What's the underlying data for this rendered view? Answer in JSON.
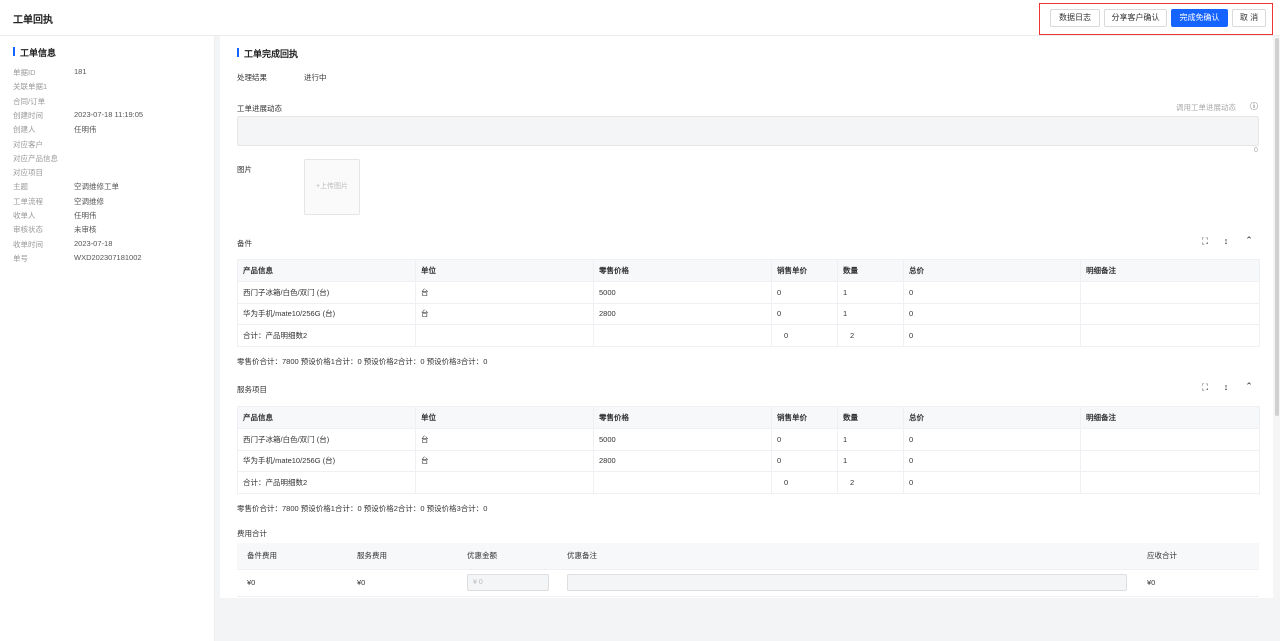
{
  "header": {
    "title": "工单回执",
    "buttons": {
      "log": "数据日志",
      "share": "分享客户确认",
      "confirm": "完成免确认",
      "cancel": "取 消"
    }
  },
  "info": {
    "title": "工单信息",
    "rows": [
      {
        "k": "单据ID",
        "v": "181"
      },
      {
        "k": "关联单据1",
        "v": ""
      },
      {
        "k": "合同/订单",
        "v": ""
      },
      {
        "k": "创建时间",
        "v": "2023-07-18 11:19:05"
      },
      {
        "k": "创建人",
        "v": "任明伟"
      },
      {
        "k": "对应客户",
        "v": ""
      },
      {
        "k": "对应产品信息",
        "v": ""
      },
      {
        "k": "对应项目",
        "v": ""
      },
      {
        "k": "主题",
        "v": "空调维修工单"
      },
      {
        "k": "工单流程",
        "v": "空调维修"
      },
      {
        "k": "收单人",
        "v": "任明伟"
      },
      {
        "k": "审核状态",
        "v": "未审核"
      },
      {
        "k": "收单时间",
        "v": "2023-07-18"
      },
      {
        "k": "单号",
        "v": "WXD202307181002"
      }
    ]
  },
  "receipt": {
    "title": "工单完成回执",
    "result_label": "处理结果",
    "result_value": "进行中",
    "progress_label": "工单进展动态",
    "progress_link": "调用工单进展动态",
    "char_count": "0",
    "image_label": "图片",
    "upload_label": "+上传图片"
  },
  "parts": {
    "title": "备件",
    "columns": [
      "产品信息",
      "单位",
      "零售价格",
      "销售单价",
      "数量",
      "总价",
      "明细备注"
    ],
    "rows": [
      {
        "name": "西门子冰箱/白色/双门 (台)",
        "unit": "台",
        "retail": "5000",
        "price": "0",
        "qty": "1",
        "total": "0",
        "note": ""
      },
      {
        "name": "华为手机/mate10/256G (台)",
        "unit": "台",
        "retail": "2800",
        "price": "0",
        "qty": "1",
        "total": "0",
        "note": ""
      }
    ],
    "total_row": {
      "label": "合计：产品明细数2",
      "price": "0",
      "qty": "2",
      "total": "0"
    },
    "summary": "零售价合计：7800  预设价格1合计：0  预设价格2合计：0  预设价格3合计：0"
  },
  "services": {
    "title": "服务项目",
    "columns": [
      "产品信息",
      "单位",
      "零售价格",
      "销售单价",
      "数量",
      "总价",
      "明细备注"
    ],
    "rows": [
      {
        "name": "西门子冰箱/白色/双门 (台)",
        "unit": "台",
        "retail": "5000",
        "price": "0",
        "qty": "1",
        "total": "0",
        "note": ""
      },
      {
        "name": "华为手机/mate10/256G (台)",
        "unit": "台",
        "retail": "2800",
        "price": "0",
        "qty": "1",
        "total": "0",
        "note": ""
      }
    ],
    "total_row": {
      "label": "合计：产品明细数2",
      "price": "0",
      "qty": "2",
      "total": "0"
    },
    "summary": "零售价合计：7800  预设价格1合计：0  预设价格2合计：0  预设价格3合计：0"
  },
  "fees": {
    "title": "费用合计",
    "columns": [
      "备件费用",
      "服务费用",
      "优惠金额",
      "优惠备注",
      "应收合计"
    ],
    "parts_fee": "¥0",
    "service_fee": "¥0",
    "discount_placeholder": "¥ 0",
    "discount_note": "",
    "receivable": "¥0"
  },
  "icons": {
    "fullscreen": "fullscreen-icon",
    "sort": "sort-icon",
    "collapse": "chevron-up-icon",
    "help": "question-circle-icon"
  },
  "colors": {
    "primary": "#1664ff",
    "highlight_border": "#e33333"
  }
}
